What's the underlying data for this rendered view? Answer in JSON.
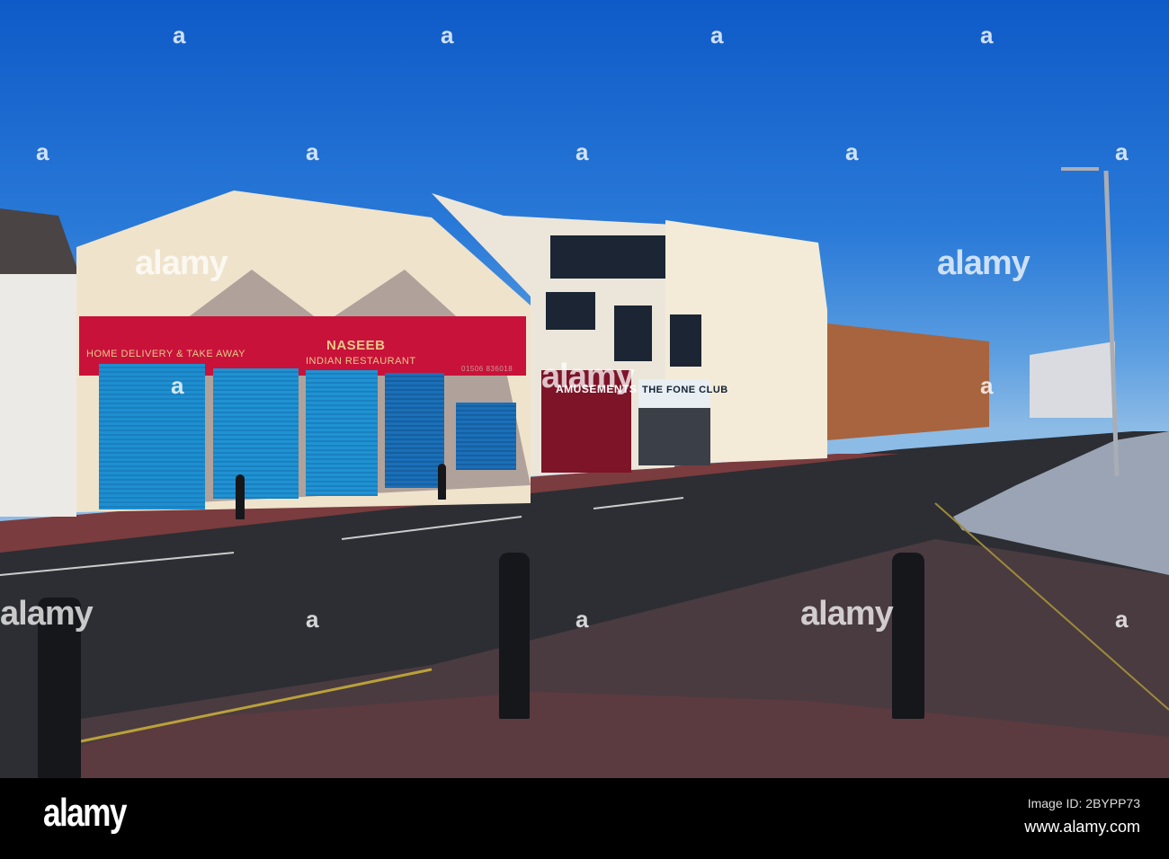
{
  "signs": {
    "restaurant_name": "NASEEB",
    "restaurant_subtitle": "INDIAN RESTAURANT",
    "restaurant_tagline": "HOME DELIVERY & TAKE AWAY",
    "restaurant_phone": "01506 836018",
    "amusements": "AMUSEMENTS",
    "fone_club": "THE FONE CLUB"
  },
  "watermark": {
    "text": "alamy",
    "letter": "a"
  },
  "footer": {
    "logo": "alamy",
    "image_id": "Image ID: 2BYPP73",
    "url": "www.alamy.com"
  },
  "colors": {
    "sky": "#1f6fd0",
    "sign_red": "#c8123a",
    "shutter_blue": "#1d8fd0",
    "road": "#2a2c31",
    "paving": "#5a3a3c"
  }
}
